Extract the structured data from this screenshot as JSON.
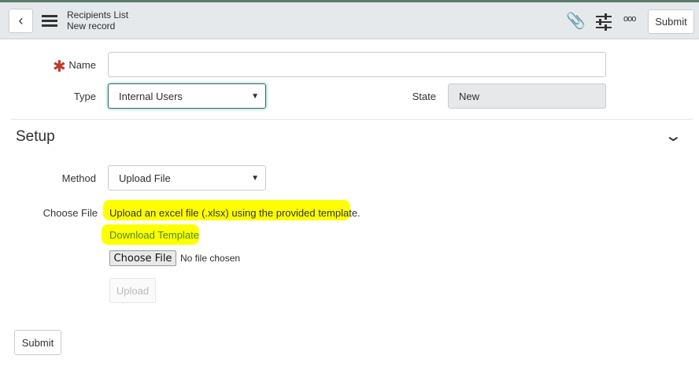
{
  "header": {
    "title": "Recipients List",
    "subtitle": "New record",
    "submit_label": "Submit"
  },
  "form": {
    "name_label": "Name",
    "name_value": "",
    "type_label": "Type",
    "type_value": "Internal Users",
    "state_label": "State",
    "state_value": "New"
  },
  "setup": {
    "section_title": "Setup",
    "method_label": "Method",
    "method_value": "Upload File",
    "choose_file_label": "Choose File",
    "instructions": "Upload an excel file (.xlsx) using the provided template.",
    "download_link": "Download Template",
    "file_button": "Choose File",
    "file_status": "No file chosen",
    "upload_button": "Upload"
  },
  "footer": {
    "submit_label": "Submit"
  },
  "colors": {
    "highlight": "#ffff00",
    "required": "#c0392b",
    "link": "#4a8a1e"
  }
}
